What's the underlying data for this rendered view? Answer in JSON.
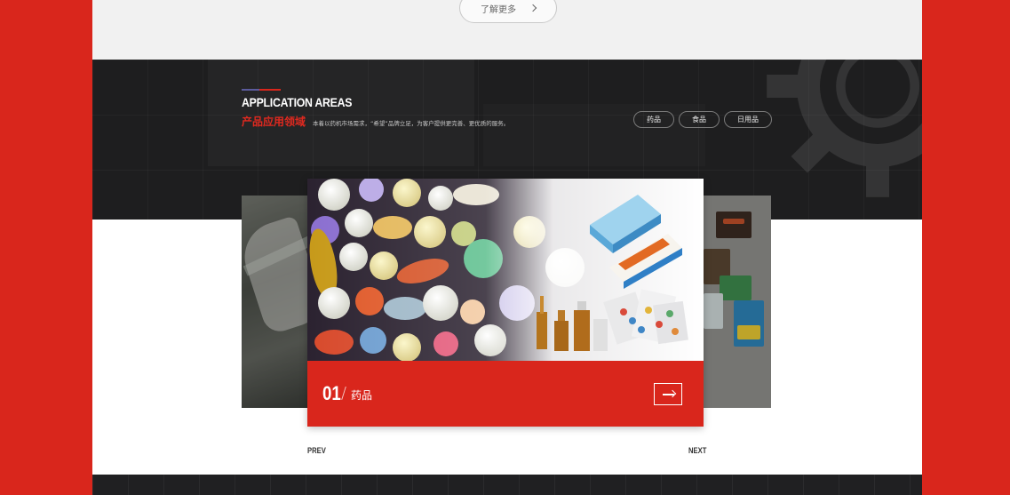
{
  "top": {
    "more_label": "了解更多"
  },
  "section": {
    "title_en": "APPLICATION AREAS",
    "title_cn": "产品应用领域",
    "description": "本着以药机市场需求，“希望”品牌立足，为客户提供更完善、更优质的服务。"
  },
  "tabs": [
    {
      "label": "药品"
    },
    {
      "label": "食品"
    },
    {
      "label": "日用品"
    }
  ],
  "carousel": {
    "active": {
      "number": "01",
      "label": "药品"
    },
    "prev_label": "PREV",
    "next_label": "NEXT"
  },
  "colors": {
    "brand_red": "#d9261c",
    "dark_band": "#1e1e1f",
    "light_strip": "#f1f1f1"
  }
}
